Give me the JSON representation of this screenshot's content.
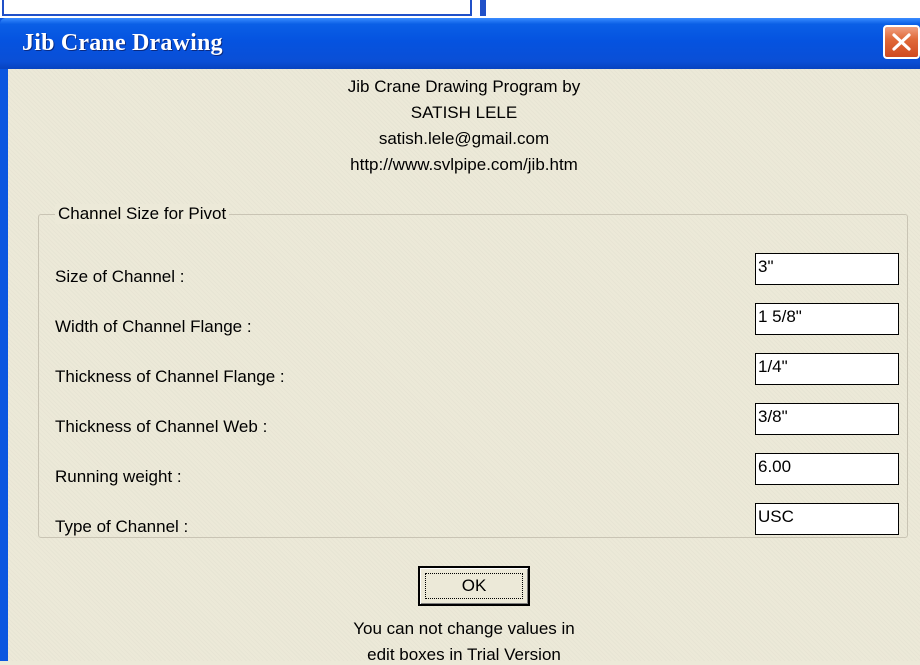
{
  "window": {
    "title": "Jib Crane Drawing"
  },
  "about": {
    "line1": "Jib Crane Drawing Program by",
    "author": "SATISH LELE",
    "email": "satish.lele@gmail.com",
    "url": "http://www.svlpipe.com/jib.htm"
  },
  "group": {
    "title": "Channel Size for Pivot",
    "fields": [
      {
        "label": "Size of Channel :",
        "value": "3\""
      },
      {
        "label": "Width of Channel Flange :",
        "value": "1 5/8\""
      },
      {
        "label": "Thickness of Channel Flange :",
        "value": "1/4\""
      },
      {
        "label": "Thickness of Channel Web :",
        "value": "3/8\""
      },
      {
        "label": "Running weight :",
        "value": "6.00"
      },
      {
        "label": "Type of Channel :",
        "value": "USC"
      }
    ]
  },
  "buttons": {
    "ok_label": "OK"
  },
  "notice": {
    "line1": "You can not change values in",
    "line2": "edit boxes in Trial Version"
  },
  "icons": {
    "close": "close-icon"
  },
  "colors": {
    "titlebar": "#0553e0",
    "close_button": "#d04a20",
    "dialog_background": "#ece9d8"
  }
}
